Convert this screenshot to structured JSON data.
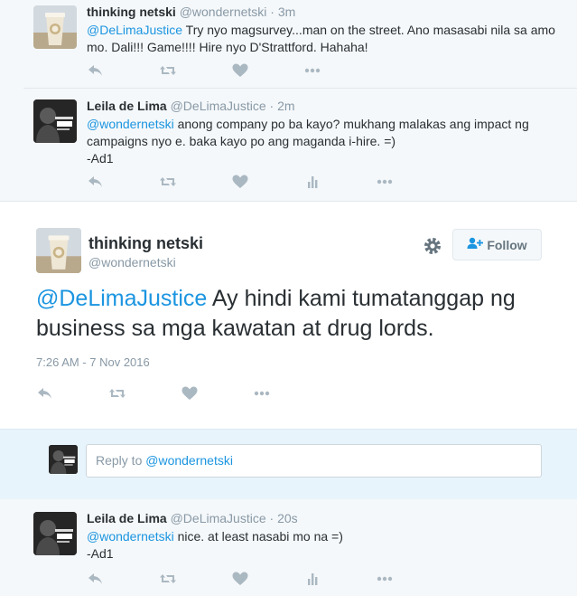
{
  "thread_top": [
    {
      "name": "thinking netski",
      "handle": "@wondernetski",
      "dot": "·",
      "time": "3m",
      "mention": "@DeLimaJustice",
      "text": " Try nyo magsurvey...man on the street. Ano masasabi nila sa amo mo. Dali!!! Game!!!! Hire nyo D'Strattford. Hahaha!",
      "signature": ""
    },
    {
      "name": "Leila de Lima",
      "handle": "@DeLimaJustice",
      "dot": "·",
      "time": "2m",
      "mention": "@wondernetski",
      "text": " anong company po ba kayo? mukhang malakas ang impact ng campaigns nyo e. baka kayo po ang maganda i-hire. =)",
      "signature": "-Ad1"
    }
  ],
  "main_tweet": {
    "name": "thinking netski",
    "handle": "@wondernetski",
    "follow_label": "Follow",
    "mention": "@DeLimaJustice",
    "text": " Ay hindi kami tumatanggap ng business sa mga kawatan at drug lords.",
    "timestamp": "7:26 AM - 7 Nov 2016"
  },
  "reply_box": {
    "prefix": "Reply to ",
    "mention": "@wondernetski"
  },
  "thread_bottom": {
    "name": "Leila de Lima",
    "handle": "@DeLimaJustice",
    "dot": "·",
    "time": "20s",
    "mention": "@wondernetski",
    "text": " nice. at least nasabi mo na =)",
    "signature": "-Ad1"
  },
  "colors": {
    "link": "#1b95e0",
    "muted": "#8899a6",
    "context_bg": "#f5f8fa",
    "reply_bg": "#e8f4fb"
  },
  "icons": {
    "reply": "reply-icon",
    "retweet": "retweet-icon",
    "like": "heart-icon",
    "analytics": "analytics-icon",
    "more": "more-icon",
    "settings": "gear-icon",
    "follow": "follow-person-icon"
  }
}
